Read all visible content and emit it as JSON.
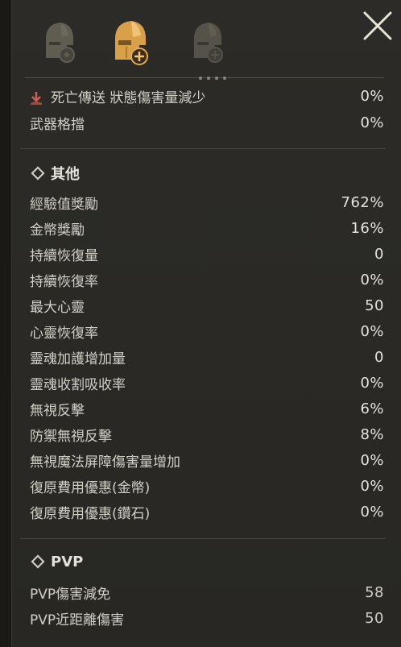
{
  "tabs": [
    {
      "icon": "helmet-gear-icon",
      "state": "inactive"
    },
    {
      "icon": "helmet-add-icon",
      "state": "active"
    },
    {
      "icon": "helmet-settings-icon",
      "state": "inactive"
    }
  ],
  "colors": {
    "active_tab": "#d9a04a",
    "inactive_tab": "#8a8576",
    "text": "#d2cfc7",
    "panel_bg": "#2b2a26"
  },
  "top_rows": [
    {
      "label": "死亡傳送 狀態傷害量減少",
      "value": "0%",
      "icon": "death-teleport-icon"
    },
    {
      "label": "武器格擋",
      "value": "0%"
    }
  ],
  "sections": {
    "other": {
      "title": "其他",
      "rows": [
        {
          "label": "經驗值獎勵",
          "value": "762%"
        },
        {
          "label": "金幣獎勵",
          "value": "16%"
        },
        {
          "label": "持續恢復量",
          "value": "0"
        },
        {
          "label": "持續恢復率",
          "value": "0%"
        },
        {
          "label": "最大心靈",
          "value": "50"
        },
        {
          "label": "心靈恢復率",
          "value": "0%"
        },
        {
          "label": "靈魂加護增加量",
          "value": "0"
        },
        {
          "label": "靈魂收割吸收率",
          "value": "0%"
        },
        {
          "label": "無視反擊",
          "value": "6%"
        },
        {
          "label": "防禦無視反擊",
          "value": "8%"
        },
        {
          "label": "無視魔法屏障傷害量增加",
          "value": "0%"
        },
        {
          "label": "復原費用優惠(金幣)",
          "value": "0%"
        },
        {
          "label": "復原費用優惠(鑽石)",
          "value": "0%"
        }
      ]
    },
    "pvp": {
      "title": "PVP",
      "rows": [
        {
          "label": "PVP傷害減免",
          "value": "58"
        },
        {
          "label": "PVP近距離傷害",
          "value": "50"
        }
      ]
    }
  }
}
